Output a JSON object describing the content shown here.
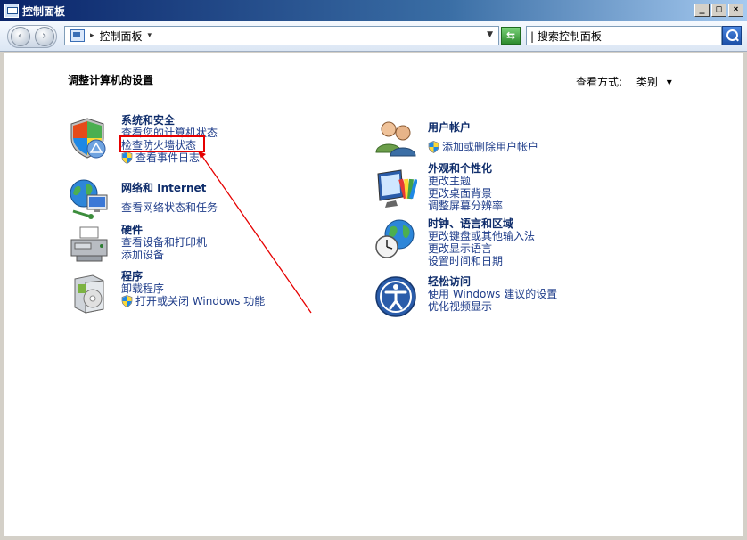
{
  "window": {
    "title": "控制面板"
  },
  "toolbar": {
    "breadcrumb": "控制面板",
    "search_placeholder": "搜索控制面板",
    "search_value": "| 搜索控制面板"
  },
  "page": {
    "title": "调整计算机的设置",
    "view_by_label": "查看方式:",
    "view_by_value": "类别"
  },
  "categories": {
    "system_security": {
      "title": "系统和安全",
      "links": [
        "查看您的计算机状态",
        "检查防火墙状态",
        "查看事件日志"
      ]
    },
    "network": {
      "title": "网络和 Internet",
      "links": [
        "查看网络状态和任务"
      ]
    },
    "hardware": {
      "title": "硬件",
      "links": [
        "查看设备和打印机",
        "添加设备"
      ]
    },
    "programs": {
      "title": "程序",
      "links": [
        "卸载程序",
        "打开或关闭 Windows 功能"
      ]
    },
    "user_accounts": {
      "title": "用户帐户",
      "links": [
        "添加或删除用户帐户"
      ]
    },
    "appearance": {
      "title": "外观和个性化",
      "links": [
        "更改主题",
        "更改桌面背景",
        "调整屏幕分辨率"
      ]
    },
    "clock_region": {
      "title": "时钟、语言和区域",
      "links": [
        "更改键盘或其他输入法",
        "更改显示语言",
        "设置时间和日期"
      ]
    },
    "ease_access": {
      "title": "轻松访问",
      "links": [
        "使用 Windows 建议的设置",
        "优化视频显示"
      ]
    }
  },
  "colors": {
    "highlight": "#e60000",
    "link": "#1f3d8a",
    "heading": "#0f2d6b"
  }
}
